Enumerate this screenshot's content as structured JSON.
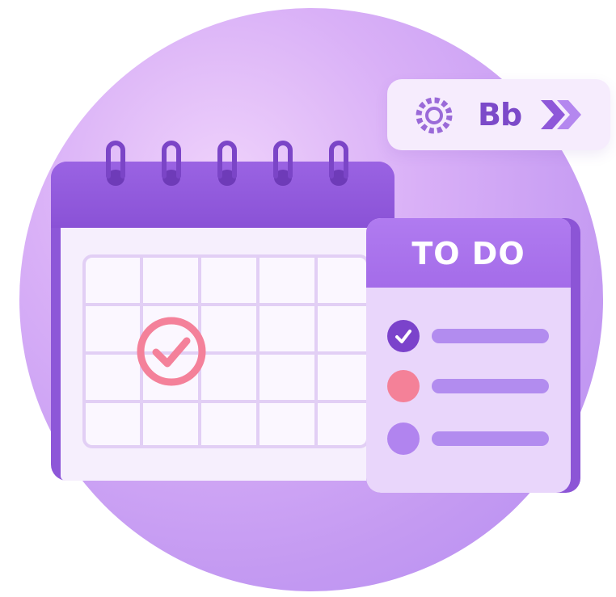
{
  "toolbar": {
    "logo_text": "Bb",
    "icons": [
      "dial-icon",
      "double-chevron-right-icon"
    ]
  },
  "calendar": {
    "rings": 5,
    "rows": 4,
    "cols": 5,
    "marked_cell": {
      "row": 2,
      "col": 2,
      "icon": "check-circle-icon"
    }
  },
  "todo": {
    "title": "TO DO",
    "items": [
      {
        "status": "done",
        "icon": "check-icon"
      },
      {
        "status": "alert",
        "icon": "dot-icon"
      },
      {
        "status": "pending",
        "icon": "dot-icon"
      }
    ]
  },
  "colors": {
    "primary_purple": "#8d57d8",
    "light_purple": "#e9d6fb",
    "accent_pink": "#f48198",
    "background_circle": "#c49af2"
  }
}
